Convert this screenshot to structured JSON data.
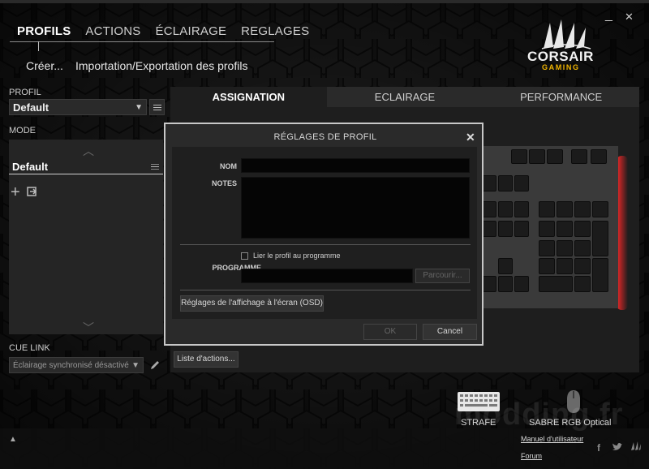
{
  "window": {
    "minimize": "_",
    "close": "✕"
  },
  "nav": {
    "tabs": [
      "PROFILS",
      "ACTIONS",
      "ÉCLAIRAGE",
      "REGLAGES"
    ],
    "sub": {
      "create": "Créer...",
      "import_export": "Importation/Exportation des profils"
    }
  },
  "logo": {
    "brand": "CORSAIR",
    "sub": "GAMING"
  },
  "left": {
    "profil_label": "PROFIL",
    "profil_value": "Default",
    "mode_label": "MODE",
    "mode_item": "Default",
    "cue_link_label": "CUE LINK",
    "cue_link_value": "Éclairage synchronisé désactivé"
  },
  "main_tabs": [
    "ASSIGNATION",
    "ECLAIRAGE",
    "PERFORMANCE"
  ],
  "actions_button": "Liste d'actions...",
  "dialog": {
    "title": "RÉGLAGES DE PROFIL",
    "close": "✕",
    "nom_label": "NOM",
    "notes_label": "NOTES",
    "link_checkbox": "Lier le profil au programme",
    "programme_label": "PROGRAMME",
    "browse": "Parcourir...",
    "osd_button": "Réglages de l'affichage à l'écran (OSD)",
    "ok": "OK",
    "cancel": "Cancel"
  },
  "devices": [
    {
      "name": "STRAFE",
      "icon": "keyboard-icon"
    },
    {
      "name": "SABRE RGB Optical",
      "icon": "mouse-icon"
    }
  ],
  "links": {
    "manual": "Manuel d'utilisateur",
    "forum": "Forum"
  },
  "watermark": "modding.fr",
  "colors": {
    "accent": "#f0b400",
    "glow": "#ff2a2a"
  }
}
